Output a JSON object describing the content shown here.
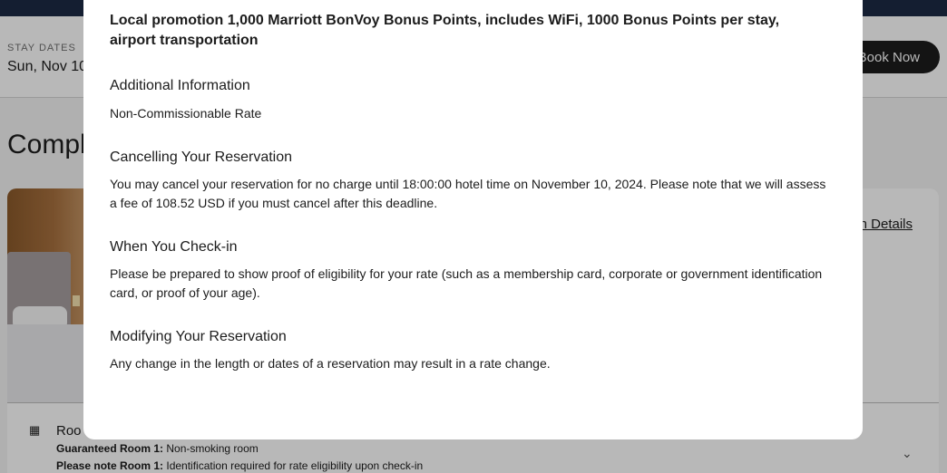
{
  "background": {
    "stay_label": "STAY DATES",
    "stay_value": "Sun, Nov 10",
    "book_button": "Book Now",
    "page_title": "Compl",
    "details_link": "n Details",
    "room_label": "Roo",
    "guaranteed_label": "Guaranteed Room 1:",
    "guaranteed_value": " Non-smoking room",
    "note_label": "Please note Room 1:",
    "note_value": " Identification required for rate eligibility upon check-in"
  },
  "modal": {
    "promo_text": "Local promotion 1,000 Marriott BonVoy Bonus Points, includes WiFi, 1000 Bonus Points per stay, airport transportation",
    "sections": [
      {
        "title": "Additional Information",
        "body": "Non-Commissionable Rate"
      },
      {
        "title": "Cancelling Your Reservation",
        "body": "You may cancel your reservation for no charge until 18:00:00 hotel time on November 10, 2024. Please note that we will assess a fee of 108.52 USD if you must cancel after this deadline."
      },
      {
        "title": "When You Check-in",
        "body": "Please be prepared to show proof of eligibility for your rate (such as a membership card, corporate or government identification card, or proof of your age)."
      },
      {
        "title": "Modifying Your Reservation",
        "body": "Any change in the length or dates of a reservation may result in a rate change."
      }
    ]
  },
  "icons": {
    "room": "bed-icon",
    "chevron": "chevron-down-icon"
  },
  "colors": {
    "topbar": "#1c2a44",
    "button": "#1c1c1c",
    "text": "#1c1c1c"
  }
}
